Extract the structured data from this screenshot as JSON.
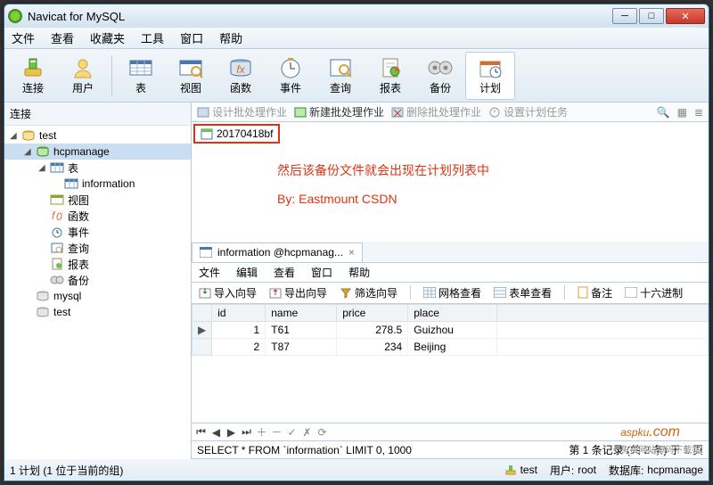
{
  "window": {
    "title": "Navicat for MySQL"
  },
  "menubar": {
    "items": [
      "文件",
      "查看",
      "收藏夹",
      "工具",
      "窗口",
      "帮助"
    ]
  },
  "toolbar": {
    "items": [
      "连接",
      "用户",
      "表",
      "视图",
      "函数",
      "事件",
      "查询",
      "报表",
      "备份",
      "计划"
    ]
  },
  "sidebar": {
    "header": "连接",
    "nodes": [
      {
        "label": "test",
        "depth": 0,
        "twisty": "◢",
        "icon": "db-open"
      },
      {
        "label": "hcpmanage",
        "depth": 1,
        "twisty": "◢",
        "icon": "db-green",
        "selected": true
      },
      {
        "label": "表",
        "depth": 2,
        "twisty": "◢",
        "icon": "table"
      },
      {
        "label": "information",
        "depth": 3,
        "twisty": "",
        "icon": "table"
      },
      {
        "label": "视图",
        "depth": 2,
        "twisty": "",
        "icon": "view"
      },
      {
        "label": "函数",
        "depth": 2,
        "twisty": "",
        "icon": "fx"
      },
      {
        "label": "事件",
        "depth": 2,
        "twisty": "",
        "icon": "event"
      },
      {
        "label": "查询",
        "depth": 2,
        "twisty": "",
        "icon": "query"
      },
      {
        "label": "报表",
        "depth": 2,
        "twisty": "",
        "icon": "report"
      },
      {
        "label": "备份",
        "depth": 2,
        "twisty": "",
        "icon": "backup"
      },
      {
        "label": "mysql",
        "depth": 1,
        "twisty": "",
        "icon": "db-gray"
      },
      {
        "label": "test",
        "depth": 1,
        "twisty": "",
        "icon": "db-gray"
      }
    ]
  },
  "subtoolbar": {
    "items": [
      {
        "label": "设计批处理作业",
        "dim": true
      },
      {
        "label": "新建批处理作业",
        "dim": false
      },
      {
        "label": "删除批处理作业",
        "dim": true
      },
      {
        "label": "设置计划任务",
        "dim": true
      }
    ]
  },
  "canvas": {
    "plan_item": "20170418bf",
    "annotation1": "然后该备份文件就会出现在计划列表中",
    "annotation2": "By: Eastmount CSDN"
  },
  "tab": {
    "title": "information @hcpmanag...",
    "close": "×"
  },
  "submenu": {
    "items": [
      "文件",
      "编辑",
      "查看",
      "窗口",
      "帮助"
    ]
  },
  "subtb": {
    "items": [
      "导入向导",
      "导出向导",
      "筛选向导",
      "网格查看",
      "表单查看",
      "备注",
      "十六进制"
    ]
  },
  "grid": {
    "columns": [
      "id",
      "name",
      "price",
      "place"
    ],
    "rows": [
      {
        "id": 1,
        "name": "T61",
        "price": 278.5,
        "place": "Guizhou",
        "current": true
      },
      {
        "id": 2,
        "name": "T87",
        "price": 234,
        "place": "Beijing",
        "current": false
      }
    ]
  },
  "sqlbar": {
    "sql": "SELECT * FROM `information` LIMIT 0, 1000",
    "record": "第 1 条记录 (共 2 条) 于 1 页"
  },
  "statusbar": {
    "plan": "1 计划 (1 位于当前的组)",
    "conn": "test",
    "user_label": "用户:",
    "user": "root",
    "db_label": "数据库:",
    "db": "hcpmanage"
  },
  "watermark": {
    "brand": "aspku",
    "tld": ".com",
    "sub": "免费网站源码下载站!"
  }
}
